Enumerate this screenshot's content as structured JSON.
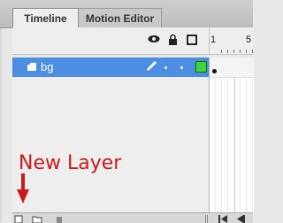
{
  "tabs": [
    {
      "label": "Timeline",
      "active": true
    },
    {
      "label": "Motion Editor",
      "active": false
    }
  ],
  "header": {
    "icons": [
      "eye-icon",
      "lock-icon",
      "outline-icon"
    ],
    "frame_numbers": [
      "1",
      "5"
    ]
  },
  "layers": [
    {
      "name": "bg",
      "selected": true,
      "outline_color": "#3ed43e"
    }
  ],
  "annotation": {
    "text": "New Layer",
    "color": "#cc1a1a"
  },
  "bottom_bar": {
    "icons": [
      "new-layer-icon",
      "new-folder-icon",
      "delete-layer-icon",
      "first-frame-icon",
      "previous-frame-icon"
    ]
  },
  "colors": {
    "selection": "#4d8ee3",
    "panel": "#eeeeee"
  }
}
